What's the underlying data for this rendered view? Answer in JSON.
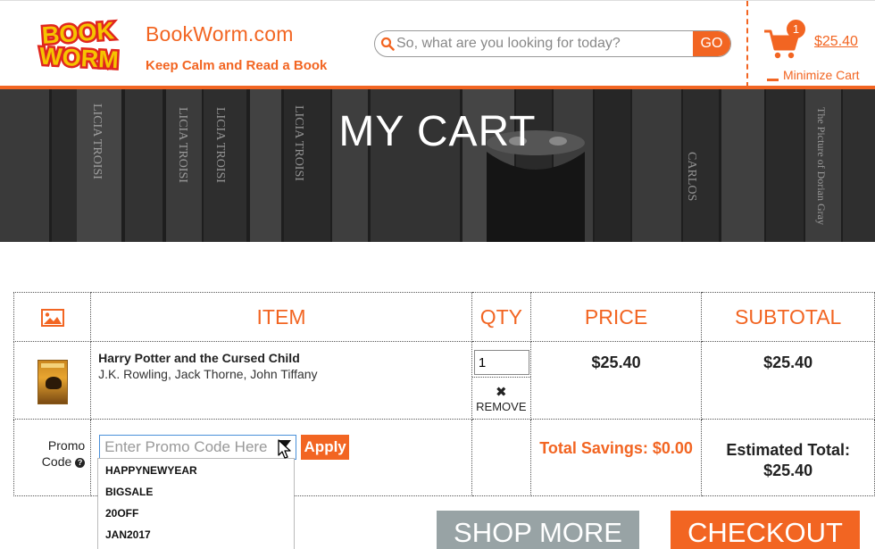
{
  "brand": {
    "logo_text_top": "BOOK",
    "logo_text_bottom": "WORM",
    "name": "BookWorm.com",
    "tagline": "Keep Calm and Read a Book",
    "color": "#f26522"
  },
  "search": {
    "placeholder": "So, what are you looking for today?",
    "go_label": "GO",
    "icon": "search-icon"
  },
  "cart": {
    "count": "1",
    "total": "$25.40",
    "minimize_label": "Minimize Cart",
    "icon": "shopping-cart-icon"
  },
  "hero": {
    "title": "MY CART",
    "spines": [
      "LICIA TROISI",
      "LICIA TROISI",
      "LICIA TROISI",
      "LICIA TROISI",
      "CARLOS",
      "The Picture of Dorian Gray"
    ]
  },
  "table": {
    "headers": {
      "image_icon": "image-icon",
      "item": "ITEM",
      "qty": "QTY",
      "price": "PRICE",
      "subtotal": "SUBTOTAL"
    },
    "rows": [
      {
        "title": "Harry Potter and the Cursed Child",
        "authors": "J.K. Rowling, Jack Thorne, John Tiffany",
        "qty": "1",
        "remove_label": "REMOVE",
        "price": "$25.40",
        "subtotal": "$25.40"
      }
    ]
  },
  "promo": {
    "label_line1": "Promo",
    "label_line2": "Code",
    "help_icon": "question-icon",
    "placeholder": "Enter Promo Code Here",
    "apply_label": "Apply",
    "options": [
      "HAPPYNEWYEAR",
      "BIGSALE",
      "20OFF",
      "JAN2017"
    ]
  },
  "totals": {
    "savings": "Total Savings: $0.00",
    "estimated_label": "Estimated Total:",
    "estimated_value": "$25.40"
  },
  "actions": {
    "shop_more": "SHOP MORE",
    "checkout": "CHECKOUT"
  }
}
